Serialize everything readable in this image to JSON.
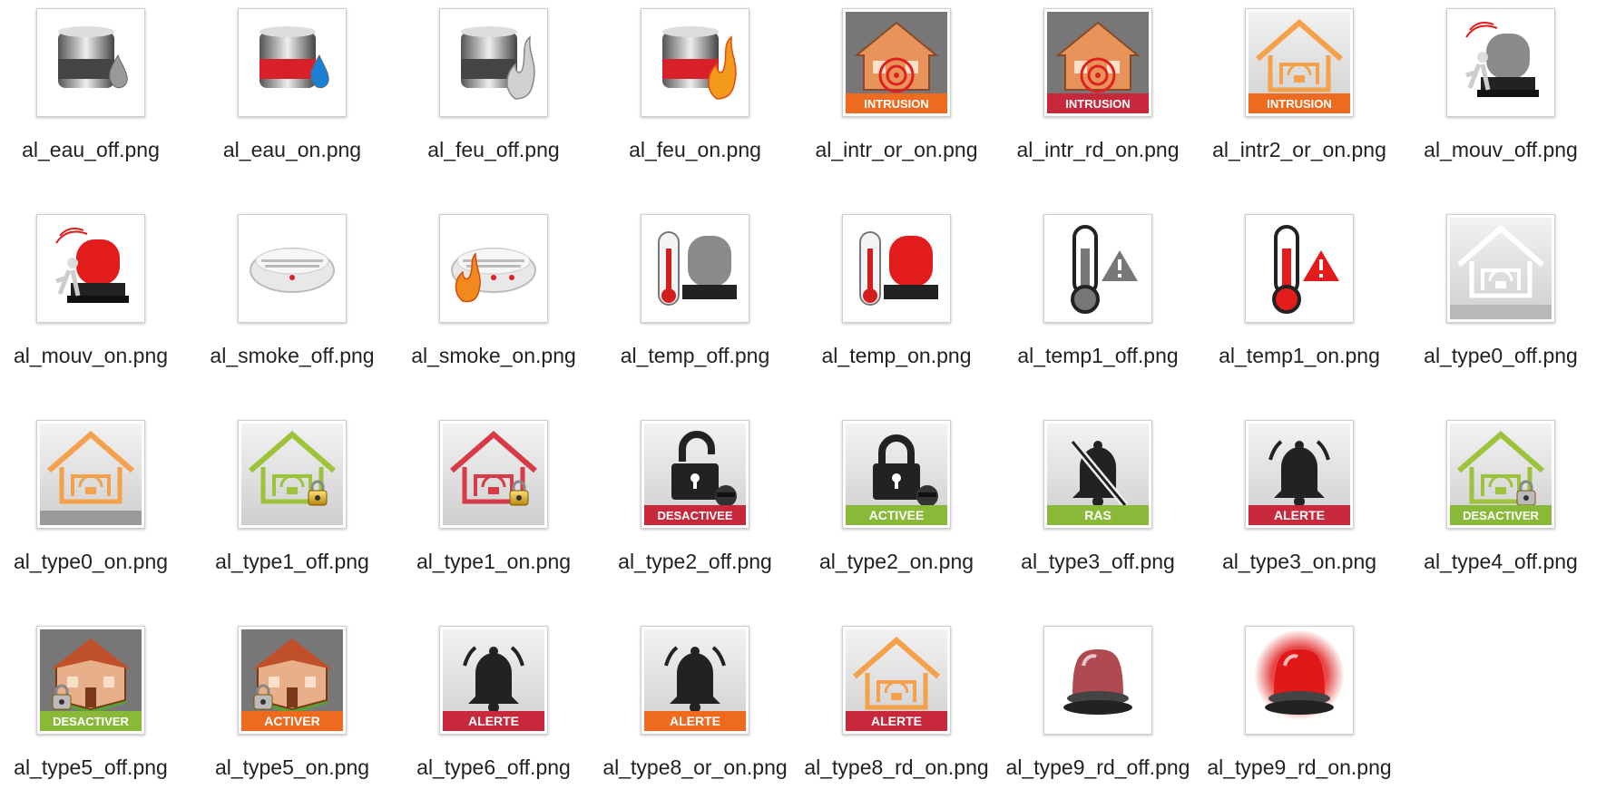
{
  "files": [
    {
      "name": "al_eau_off.png",
      "icon": "grey-tank-water-drop-icon",
      "kind": "tank",
      "state": "off",
      "symbol": "drop"
    },
    {
      "name": "al_eau_on.png",
      "icon": "red-tank-blue-water-drop-icon",
      "kind": "tank",
      "state": "on",
      "symbol": "drop"
    },
    {
      "name": "al_feu_off.png",
      "icon": "grey-tank-flame-icon",
      "kind": "tank",
      "state": "off",
      "symbol": "flame"
    },
    {
      "name": "al_feu_on.png",
      "icon": "red-tank-flame-icon",
      "kind": "tank",
      "state": "on",
      "symbol": "flame"
    },
    {
      "name": "al_intr_or_on.png",
      "icon": "house-intrusion-orange-icon",
      "kind": "intrusion",
      "banner": "INTRUSION",
      "bannerColor": "#ee6a1f"
    },
    {
      "name": "al_intr_rd_on.png",
      "icon": "house-intrusion-red-icon",
      "kind": "intrusion",
      "banner": "INTRUSION",
      "bannerColor": "#c8283c"
    },
    {
      "name": "al_intr2_or_on.png",
      "icon": "house-outline-intrusion-orange-icon",
      "kind": "houseline",
      "lineColor": "#f5a04a",
      "banner": "INTRUSION",
      "bannerColor": "#ee6a1f"
    },
    {
      "name": "al_mouv_off.png",
      "icon": "grey-beacon-motion-icon",
      "kind": "beacon",
      "state": "off"
    },
    {
      "name": "al_mouv_on.png",
      "icon": "red-beacon-motion-icon",
      "kind": "beacon",
      "state": "on"
    },
    {
      "name": "al_smoke_off.png",
      "icon": "smoke-detector-icon",
      "kind": "smoke",
      "state": "off"
    },
    {
      "name": "al_smoke_on.png",
      "icon": "smoke-detector-flame-icon",
      "kind": "smoke",
      "state": "on"
    },
    {
      "name": "al_temp_off.png",
      "icon": "thermometer-grey-beacon-icon",
      "kind": "tempbeacon",
      "state": "off"
    },
    {
      "name": "al_temp_on.png",
      "icon": "thermometer-red-beacon-icon",
      "kind": "tempbeacon",
      "state": "on"
    },
    {
      "name": "al_temp1_off.png",
      "icon": "thermometer-warning-grey-icon",
      "kind": "thermo",
      "state": "off"
    },
    {
      "name": "al_temp1_on.png",
      "icon": "thermometer-warning-red-icon",
      "kind": "thermo",
      "state": "on"
    },
    {
      "name": "al_type0_off.png",
      "icon": "house-outline-white-icon",
      "kind": "houseline",
      "lineColor": "#ffffff",
      "banner": "",
      "bannerColor": "#b8b8b8"
    },
    {
      "name": "al_type0_on.png",
      "icon": "house-outline-orange-icon",
      "kind": "houseline",
      "lineColor": "#f5a04a",
      "banner": "",
      "bannerColor": "#9a9a9a"
    },
    {
      "name": "al_type1_off.png",
      "icon": "house-outline-green-padlock-icon",
      "kind": "houseline",
      "lineColor": "#9cc33a",
      "banner": "",
      "bannerColor": "",
      "lock": "gold"
    },
    {
      "name": "al_type1_on.png",
      "icon": "house-outline-red-padlock-icon",
      "kind": "houseline",
      "lineColor": "#d83a48",
      "banner": "",
      "bannerColor": "",
      "lock": "gold"
    },
    {
      "name": "al_type2_off.png",
      "icon": "unlocked-padlock-burglar-icon",
      "kind": "padlock",
      "open": true,
      "banner": "DESACTIVEE",
      "bannerColor": "#c8283c"
    },
    {
      "name": "al_type2_on.png",
      "icon": "locked-padlock-burglar-icon",
      "kind": "padlock",
      "open": false,
      "banner": "ACTIVEE",
      "bannerColor": "#8ab93a"
    },
    {
      "name": "al_type3_off.png",
      "icon": "bell-muted-icon",
      "kind": "bell",
      "muted": true,
      "banner": "RAS",
      "bannerColor": "#8ab93a"
    },
    {
      "name": "al_type3_on.png",
      "icon": "bell-ringing-icon",
      "kind": "bell",
      "muted": false,
      "banner": "ALERTE",
      "bannerColor": "#c8283c"
    },
    {
      "name": "al_type4_off.png",
      "icon": "house-outline-green-desactiver-icon",
      "kind": "houseline",
      "lineColor": "#9cc33a",
      "banner": "DESACTIVER",
      "bannerColor": "#8ab93a",
      "lock": "grey"
    },
    {
      "name": "al_type5_off.png",
      "icon": "house-3d-desactiver-icon",
      "kind": "house3d",
      "banner": "DESACTIVER",
      "bannerColor": "#8ab93a"
    },
    {
      "name": "al_type5_on.png",
      "icon": "house-3d-activer-icon",
      "kind": "house3d",
      "banner": "ACTIVER",
      "bannerColor": "#ee6a1f"
    },
    {
      "name": "al_type6_off.png",
      "icon": "bell-alerte-red-icon",
      "kind": "bell",
      "muted": false,
      "banner": "ALERTE",
      "bannerColor": "#c8283c"
    },
    {
      "name": "al_type8_or_on.png",
      "icon": "bell-alerte-orange-icon",
      "kind": "bell",
      "muted": false,
      "banner": "ALERTE",
      "bannerColor": "#ee6a1f"
    },
    {
      "name": "al_type8_rd_on.png",
      "icon": "house-outline-alerte-red-icon",
      "kind": "houseline",
      "lineColor": "#f5a04a",
      "banner": "ALERTE",
      "bannerColor": "#c8283c"
    },
    {
      "name": "al_type9_rd_off.png",
      "icon": "red-beacon-dim-icon",
      "kind": "siren",
      "state": "off"
    },
    {
      "name": "al_type9_rd_on.png",
      "icon": "red-beacon-glowing-icon",
      "kind": "siren",
      "state": "on"
    }
  ]
}
